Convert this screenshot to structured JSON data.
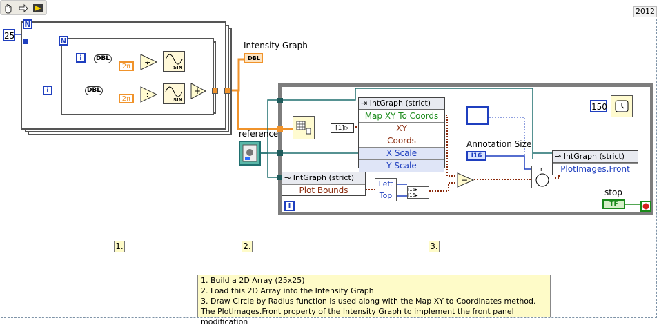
{
  "version": "2012",
  "array_size": "25",
  "loop_count_label": "N",
  "iteration_label": "i",
  "dbl_label": "DBL",
  "two_pi": "2π",
  "sin_label": "SIN",
  "intensity_graph_label": "Intensity Graph",
  "reference_label": "reference",
  "wait_ms": "150",
  "annotation_size_label": "Annotation Size",
  "annotation_size_type": "I16",
  "stop_label": "stop",
  "stop_value": "TF",
  "property_node_1": {
    "title": "IntGraph (strict)",
    "rows": [
      "Map XY To Coords",
      "XY",
      "Coords",
      "X Scale",
      "Y Scale"
    ]
  },
  "property_node_2": {
    "title": "IntGraph (strict)",
    "rows": [
      "Plot Bounds"
    ]
  },
  "property_node_3": {
    "title": "IntGraph (strict)",
    "rows": [
      "PlotImages.Front"
    ]
  },
  "unbundle": [
    "Left",
    "Top"
  ],
  "steps": [
    "1.",
    "2.",
    "3."
  ],
  "notes": [
    "1. Build a 2D Array (25x25)",
    "2. Load this 2D Array into the Intensity Graph",
    "3. Draw Circle by Radius function is used along with the Map XY to Coordinates method.",
    "The PlotImages.Front property of the Intensity Graph to implement the front panel modification"
  ],
  "colors": {
    "integer_wire": "#1f3fbf",
    "double_wire": "#f0932b",
    "ref_wire": "#1f6f6f",
    "cluster_wire": "#8b2c0e",
    "boolean_wire": "#1a8a1a"
  }
}
